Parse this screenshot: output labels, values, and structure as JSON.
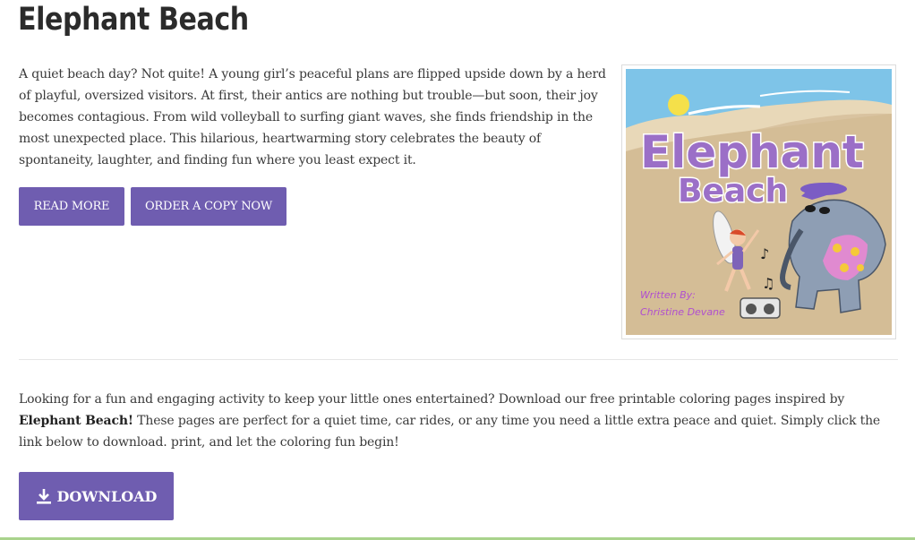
{
  "page": {
    "title": "Elephant Beach"
  },
  "intro": {
    "text": "A quiet beach day? Not quite! A young girl’s peaceful plans are flipped upside down by a herd of playful, oversized visitors. At first, their antics are nothing but trouble—but soon, their joy becomes contagious. From wild volleyball to surfing giant waves, she finds friendship in the most unexpected place. This hilarious, heartwarming story celebrates the beauty of spontaneity, laughter, and finding fun where you least expect it."
  },
  "buttons": {
    "read_more": "READ MORE",
    "order": "ORDER A COPY NOW",
    "download": "DOWNLOAD"
  },
  "cover": {
    "title_line1": "Elephant",
    "title_line2": "Beach",
    "written_by": "Written By:",
    "author": "Christine Devane"
  },
  "coloring": {
    "before": "Looking for a fun and engaging activity to keep your little ones entertained? Download our free printable coloring pages inspired by ",
    "bold": "Elephant Beach!",
    "after": " These pages are perfect for a quiet time, car rides, or any time you need a little extra peace and quiet. Simply click the link below to download. print, and let the coloring fun begin!"
  },
  "colors": {
    "button": "#6f5db0",
    "accent_line": "#a9d38c"
  }
}
